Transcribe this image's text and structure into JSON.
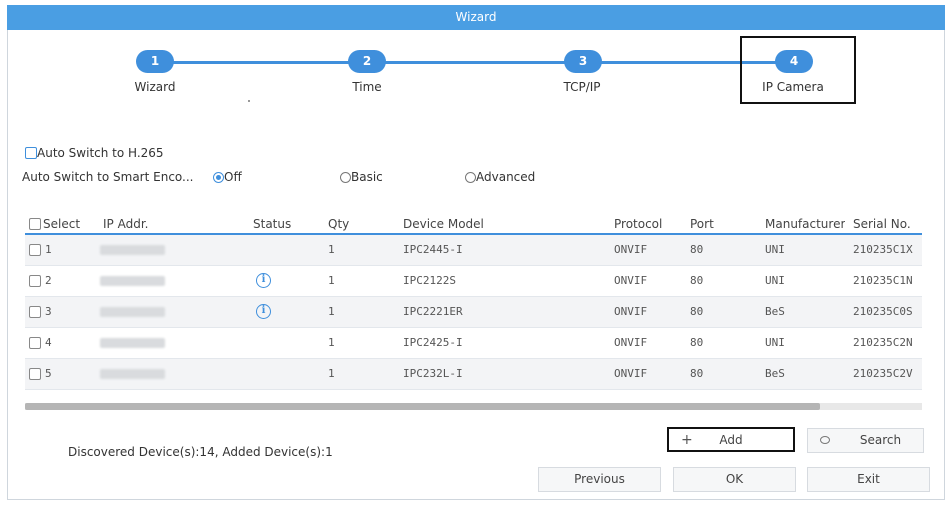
{
  "window": {
    "title": "Wizard"
  },
  "steps": [
    {
      "num": "1",
      "label": "Wizard"
    },
    {
      "num": "2",
      "label": "Time"
    },
    {
      "num": "3",
      "label": "TCP/IP"
    },
    {
      "num": "4",
      "label": "IP Camera"
    }
  ],
  "options": {
    "auto_switch_h265": "Auto Switch to H.265",
    "smart_encode_label": "Auto Switch to Smart Enco...",
    "radio_off": "Off",
    "radio_basic": "Basic",
    "radio_advanced": "Advanced",
    "selected_radio": "Off"
  },
  "table": {
    "headers": {
      "select": "Select",
      "ip": "IP Addr.",
      "status": "Status",
      "qty": "Qty",
      "model": "Device Model",
      "protocol": "Protocol",
      "port": "Port",
      "manufacturer": "Manufacturer",
      "serial": "Serial No."
    },
    "rows": [
      {
        "num": "1",
        "status_icon": "",
        "qty": "1",
        "model": "IPC2445-I",
        "protocol": "ONVIF",
        "port": "80",
        "manufacturer": "UNI",
        "serial": "210235C1X"
      },
      {
        "num": "2",
        "status_icon": "info-icon",
        "qty": "1",
        "model": "IPC2122S",
        "protocol": "ONVIF",
        "port": "80",
        "manufacturer": "UNI",
        "serial": "210235C1N"
      },
      {
        "num": "3",
        "status_icon": "info-icon",
        "qty": "1",
        "model": "IPC2221ER",
        "protocol": "ONVIF",
        "port": "80",
        "manufacturer": "BeS",
        "serial": "210235C0S"
      },
      {
        "num": "4",
        "status_icon": "",
        "qty": "1",
        "model": "IPC2425-I",
        "protocol": "ONVIF",
        "port": "80",
        "manufacturer": "UNI",
        "serial": "210235C2N"
      },
      {
        "num": "5",
        "status_icon": "",
        "qty": "1",
        "model": "IPC232L-I",
        "protocol": "ONVIF",
        "port": "80",
        "manufacturer": "BeS",
        "serial": "210235C2V"
      }
    ]
  },
  "footer": {
    "discovered_text": "Discovered Device(s):14, Added Device(s):1",
    "add_label": "Add",
    "search_label": "Search",
    "previous_label": "Previous",
    "ok_label": "OK",
    "exit_label": "Exit",
    "plus_glyph": "+"
  },
  "colors": {
    "accent": "#3f8fdc",
    "titlebar": "#4a9ee3"
  }
}
